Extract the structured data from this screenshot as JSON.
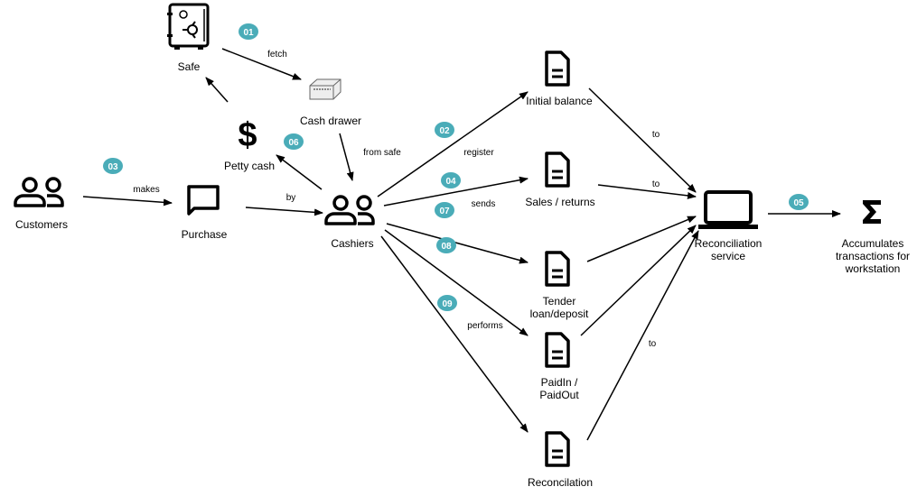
{
  "colors": {
    "badge": "#4aacb8",
    "badge_text": "#ffffff",
    "line": "#000000"
  },
  "nodes": {
    "safe": {
      "label": "Safe",
      "icon": "safe-icon"
    },
    "cash_drawer": {
      "label": "Cash drawer",
      "icon": "cash-drawer-icon"
    },
    "petty_cash": {
      "label": "Petty cash",
      "icon": "dollar-icon"
    },
    "customers": {
      "label": "Customers",
      "icon": "users-icon"
    },
    "purchase": {
      "label": "Purchase",
      "icon": "speech-bubble-icon"
    },
    "cashiers": {
      "label": "Cashiers",
      "icon": "users-icon"
    },
    "initial_balance": {
      "label": "Initial balance",
      "icon": "document-icon"
    },
    "sales_returns": {
      "label": "Sales / returns",
      "icon": "document-icon"
    },
    "tender": {
      "label1": "Tender",
      "label2": "loan/deposit",
      "icon": "document-icon"
    },
    "paidin": {
      "label1": "PaidIn /",
      "label2": "PaidOut",
      "icon": "document-icon"
    },
    "reconcilation": {
      "label": "Reconcilation",
      "icon": "document-icon"
    },
    "reconciliation_service": {
      "label1": "Reconciliation",
      "label2": "service",
      "icon": "laptop-icon"
    },
    "accumulates": {
      "label1": "Accumulates",
      "label2": "transactions for",
      "label3": "workstation",
      "icon": "sigma-icon"
    }
  },
  "edge_labels": {
    "fetch": "fetch",
    "from_safe": "from safe",
    "makes": "makes",
    "by": "by",
    "register": "register",
    "sends": "sends",
    "performs": "performs",
    "to1": "to",
    "to2": "to",
    "to3": "to"
  },
  "badges": {
    "b01": "01",
    "b02": "02",
    "b03": "03",
    "b04": "04",
    "b05": "05",
    "b06": "06",
    "b07": "07",
    "b08": "08",
    "b09": "09"
  }
}
